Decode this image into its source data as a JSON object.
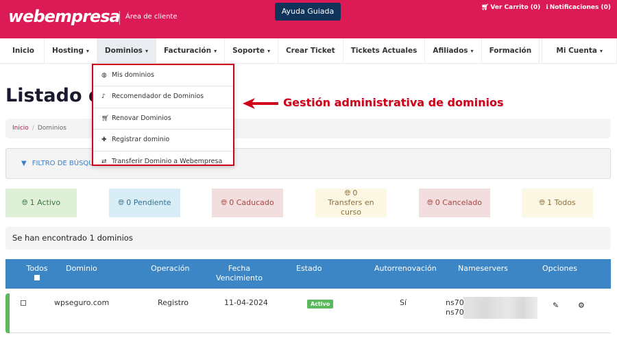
{
  "header": {
    "logo": "webempresa",
    "subtitle": "Área de cliente",
    "help_button": "Ayuda Guiada",
    "cart": "Ver Carrito (0)",
    "notifications": "Notificaciones (0)",
    "cart_icon": "cart-icon",
    "notifications_icon": "info-icon",
    "brand_color": "#dc1a55"
  },
  "nav": {
    "items": [
      {
        "label": "Inicio",
        "dropdown": false
      },
      {
        "label": "Hosting",
        "dropdown": true
      },
      {
        "label": "Dominios",
        "dropdown": true,
        "active": true
      },
      {
        "label": "Facturación",
        "dropdown": true
      },
      {
        "label": "Soporte",
        "dropdown": true
      },
      {
        "label": "Crear Ticket",
        "dropdown": false
      },
      {
        "label": "Tickets Actuales",
        "dropdown": false
      },
      {
        "label": "Afiliados",
        "dropdown": true
      },
      {
        "label": "Formación",
        "dropdown": false
      }
    ],
    "account": "Mi Cuenta",
    "caret": "▾"
  },
  "dropdown": {
    "items": [
      {
        "label": "Mis dominios",
        "icon": "globe-icon",
        "glyph": "◍"
      },
      {
        "label": "Recomendador de Dominios",
        "icon": "bell-icon",
        "glyph": "🔔"
      },
      {
        "label": "Renovar Dominios",
        "icon": "cart-icon",
        "glyph": "🛒"
      },
      {
        "label": "Registrar dominio",
        "icon": "plus-icon",
        "glyph": "✚"
      },
      {
        "label": "Transferir Dominio a Webempresa",
        "icon": "exchange-icon",
        "glyph": "⇄"
      }
    ]
  },
  "annotation": {
    "text": "Gestión administrativa de dominios",
    "color": "#d0021b"
  },
  "page": {
    "title": "Listado de Dominios",
    "breadcrumb": [
      "Inicio",
      "Dominios"
    ],
    "filter_label": "FILTRO DE BÚSQUEDA",
    "found_text": "Se han encontrado 1 dominios"
  },
  "status_boxes": [
    {
      "label": "1 Activo",
      "bg": "#dff0d8",
      "fg": "#3c763d"
    },
    {
      "label": "0 Pendiente",
      "bg": "#d9edf7",
      "fg": "#31708f"
    },
    {
      "label": "0 Caducado",
      "bg": "#f2dede",
      "fg": "#a94442"
    },
    {
      "label": "0 Transfers en curso",
      "bg": "#fcf8e3",
      "fg": "#8a6d3b"
    },
    {
      "label": "0 Cancelado",
      "bg": "#f2dede",
      "fg": "#a94442"
    },
    {
      "label": "1 Todos",
      "bg": "#fcf8e3",
      "fg": "#8a6d3b"
    }
  ],
  "table": {
    "headers": [
      "Todos",
      "Dominio",
      "Operación",
      "Fecha Vencimiento",
      "Estado",
      "Autorrenovación",
      "Nameservers",
      "Opciones"
    ],
    "rows": [
      {
        "domain": "wpseguro.com",
        "operation": "Registro",
        "expiry": "11-04-2024",
        "status": "Activo",
        "autorenew": "Sí",
        "ns1": "ns70",
        "ns2": "ns70"
      }
    ]
  }
}
